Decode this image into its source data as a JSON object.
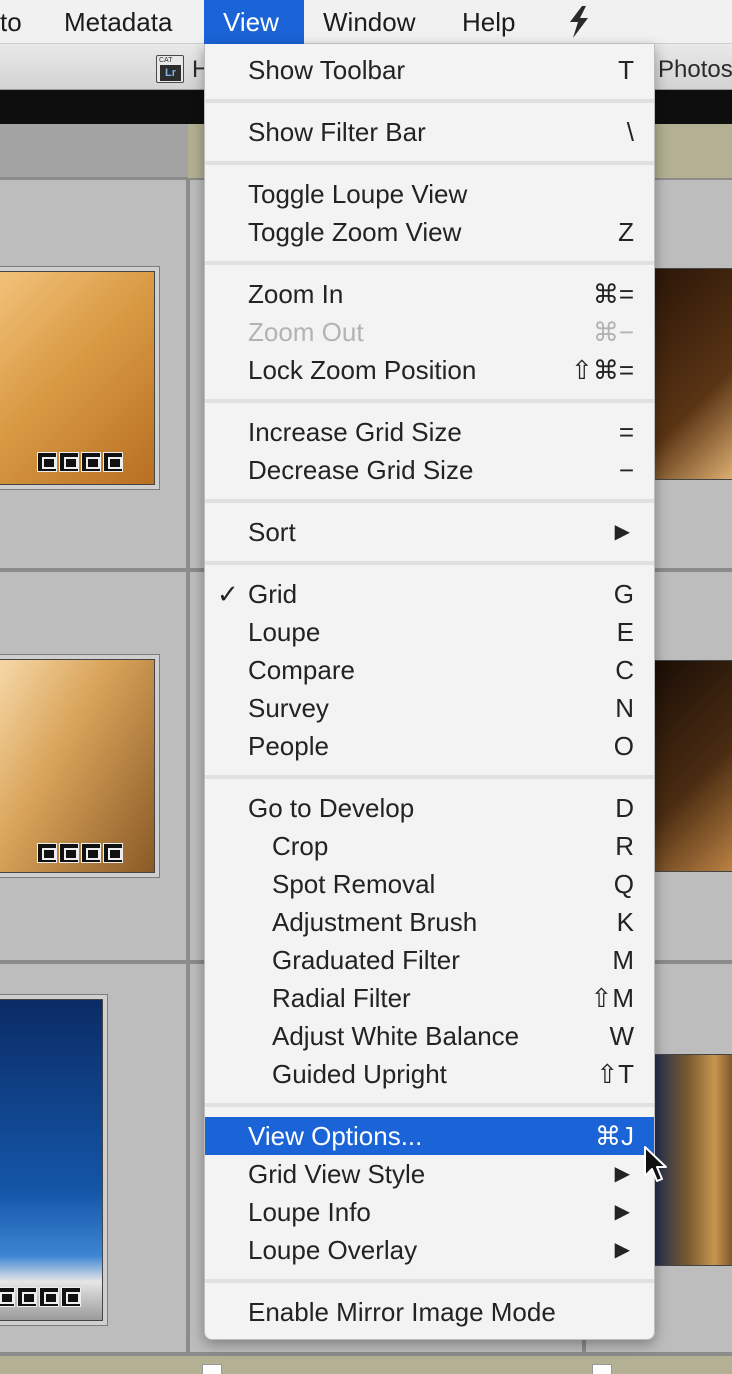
{
  "menubar": {
    "items": [
      "to",
      "Metadata",
      "View",
      "Window",
      "Help"
    ],
    "active": "View",
    "extra_icon": "bolt-icon"
  },
  "window": {
    "app_icon_small_text": "CAT",
    "app_icon_text": "Lr",
    "title_left": "H",
    "title_right": "Photos"
  },
  "menu": {
    "show_toolbar": {
      "label": "Show Toolbar",
      "shortcut": "T"
    },
    "show_filter_bar": {
      "label": "Show Filter Bar",
      "shortcut": "\\"
    },
    "toggle_loupe_view": {
      "label": "Toggle Loupe View",
      "shortcut": ""
    },
    "toggle_zoom_view": {
      "label": "Toggle Zoom View",
      "shortcut": "Z"
    },
    "zoom_in": {
      "label": "Zoom In",
      "shortcut": "⌘="
    },
    "zoom_out": {
      "label": "Zoom Out",
      "shortcut": "⌘−"
    },
    "lock_zoom_position": {
      "label": "Lock Zoom Position",
      "shortcut": "⇧⌘="
    },
    "increase_grid_size": {
      "label": "Increase Grid Size",
      "shortcut": "="
    },
    "decrease_grid_size": {
      "label": "Decrease Grid Size",
      "shortcut": "−"
    },
    "sort": {
      "label": "Sort",
      "arrow": "▶"
    },
    "grid": {
      "label": "Grid",
      "shortcut": "G",
      "check": "✓"
    },
    "loupe": {
      "label": "Loupe",
      "shortcut": "E"
    },
    "compare": {
      "label": "Compare",
      "shortcut": "C"
    },
    "survey": {
      "label": "Survey",
      "shortcut": "N"
    },
    "people": {
      "label": "People",
      "shortcut": "O"
    },
    "go_to_develop": {
      "label": "Go to Develop",
      "shortcut": "D"
    },
    "crop": {
      "label": "Crop",
      "shortcut": "R"
    },
    "spot_removal": {
      "label": "Spot Removal",
      "shortcut": "Q"
    },
    "adjustment_brush": {
      "label": "Adjustment Brush",
      "shortcut": "K"
    },
    "graduated_filter": {
      "label": "Graduated Filter",
      "shortcut": "M"
    },
    "radial_filter": {
      "label": "Radial Filter",
      "shortcut": "⇧M"
    },
    "adjust_white_balance": {
      "label": "Adjust White Balance",
      "shortcut": "W"
    },
    "guided_upright": {
      "label": "Guided Upright",
      "shortcut": "⇧T"
    },
    "view_options": {
      "label": "View Options...",
      "shortcut": "⌘J"
    },
    "grid_view_style": {
      "label": "Grid View Style",
      "arrow": "▶"
    },
    "loupe_info": {
      "label": "Loupe Info",
      "arrow": "▶"
    },
    "loupe_overlay": {
      "label": "Loupe Overlay",
      "arrow": "▶"
    },
    "enable_mirror_image_mode": {
      "label": "Enable Mirror Image Mode",
      "shortcut": ""
    }
  },
  "colors": {
    "menu_highlight": "#1a64d8",
    "menu_background": "#f3f3f3",
    "disabled_text": "#b3b3b3"
  }
}
